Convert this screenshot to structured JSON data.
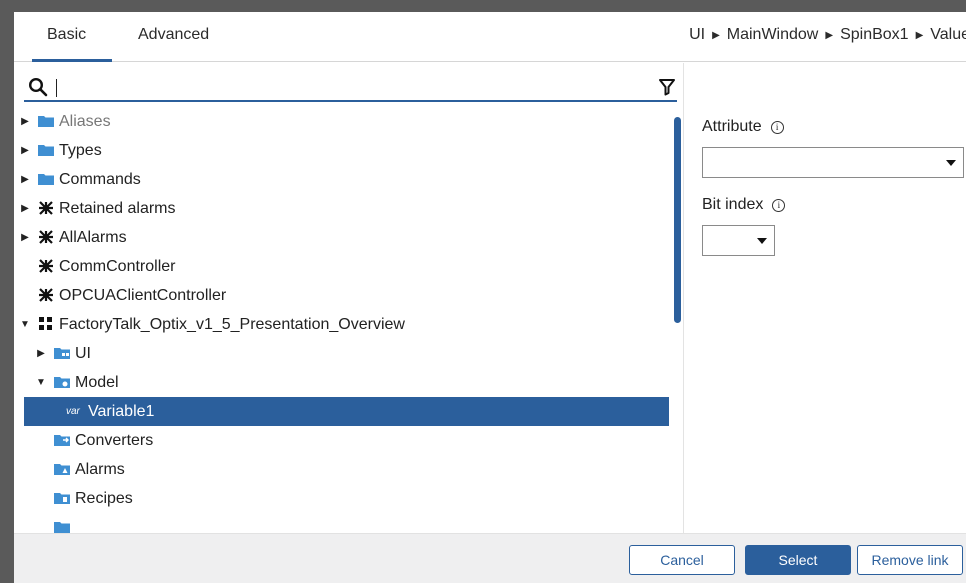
{
  "tabs": [
    {
      "label": "Basic",
      "active": true
    },
    {
      "label": "Advanced",
      "active": false
    }
  ],
  "breadcrumb": [
    "UI",
    "MainWindow",
    "SpinBox1",
    "Value"
  ],
  "search": {
    "value": "",
    "placeholder": ""
  },
  "tree": [
    {
      "label": "Aliases",
      "icon": "folder-icon",
      "expander": "collapsed",
      "muted": true
    },
    {
      "label": "Types",
      "icon": "folder-icon",
      "expander": "collapsed"
    },
    {
      "label": "Commands",
      "icon": "folder-icon",
      "expander": "collapsed"
    },
    {
      "label": "Retained alarms",
      "icon": "alarm-object-icon",
      "expander": "collapsed"
    },
    {
      "label": "AllAlarms",
      "icon": "alarm-object-icon",
      "expander": "collapsed"
    },
    {
      "label": "CommController",
      "icon": "alarm-object-icon",
      "expander": "none"
    },
    {
      "label": "OPCUAClientController",
      "icon": "alarm-object-icon",
      "expander": "none"
    },
    {
      "label": "FactoryTalk_Optix_v1_5_Presentation_Overview",
      "icon": "project-icon",
      "expander": "expanded"
    },
    {
      "label": "UI",
      "icon": "ui-folder-icon",
      "expander": "collapsed"
    },
    {
      "label": "Model",
      "icon": "model-folder-icon",
      "expander": "expanded"
    },
    {
      "label": "Variable1",
      "icon": "variable-icon",
      "icon_text": "var",
      "expander": "none",
      "selected": true
    },
    {
      "label": "Converters",
      "icon": "converters-folder-icon",
      "expander": "none"
    },
    {
      "label": "Alarms",
      "icon": "alarms-folder-icon",
      "expander": "none"
    },
    {
      "label": "Recipes",
      "icon": "recipes-folder-icon",
      "expander": "none"
    }
  ],
  "properties": {
    "attribute_label": "Attribute",
    "attribute_value": "",
    "bit_index_label": "Bit index",
    "bit_index_value": "",
    "info_glyph": "i"
  },
  "footer": {
    "cancel_label": "Cancel",
    "select_label": "Select",
    "remove_link_label": "Remove link"
  },
  "colors": {
    "accent": "#2b5f9c",
    "folder": "#3f8fd2",
    "frame": "#5a5a5a",
    "footer_bg": "#efeff0"
  }
}
